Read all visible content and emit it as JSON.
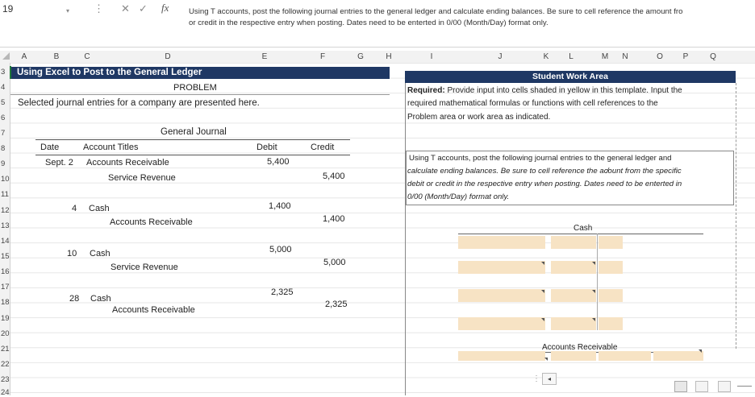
{
  "formula_bar": {
    "name_box": "19",
    "fx_label": "fx",
    "formula_line1": "Using T accounts, post the following journal entries to the general ledger and calculate ending balances. Be sure to cell reference the amount fro",
    "formula_line2": "or credit in the respective entry when posting. Dates need to be enterted in 0/00 (Month/Day) format only."
  },
  "columns": [
    "A",
    "B",
    "C",
    "D",
    "E",
    "F",
    "G",
    "H",
    "I",
    "J",
    "K",
    "L",
    "M",
    "N",
    "O",
    "P",
    "Q"
  ],
  "rows": [
    "3",
    "4",
    "5",
    "6",
    "7",
    "8",
    "9",
    "10",
    "11",
    "12",
    "13",
    "14",
    "15",
    "16",
    "17",
    "18",
    "19",
    "20",
    "21",
    "22",
    "23",
    "24"
  ],
  "left": {
    "title": "Using Excel to Post to the General Ledger",
    "problem": "PROBLEM",
    "intro": "Selected journal entries for a company are presented here.",
    "journal_title": "General Journal",
    "headers": {
      "date": "Date",
      "account": "Account Titles",
      "debit": "Debit",
      "credit": "Credit"
    },
    "entries": [
      {
        "date": "Sept. 2",
        "debit_account": "Accounts Receivable",
        "debit": "5,400",
        "credit_account": "Service Revenue",
        "credit": "5,400"
      },
      {
        "date": "4",
        "debit_account": "Cash",
        "debit": "1,400",
        "credit_account": "Accounts Receivable",
        "credit": "1,400"
      },
      {
        "date": "10",
        "debit_account": "Cash",
        "debit": "5,000",
        "credit_account": "Service Revenue",
        "credit": "5,000"
      },
      {
        "date": "28",
        "debit_account": "Cash",
        "debit": "2,325",
        "credit_account": "Accounts Receivable",
        "credit": "2,325"
      }
    ]
  },
  "right": {
    "title": "Student Work Area",
    "required_label": "Required:",
    "required_text1": " Provide input into cells shaded in yellow in this template. Input the",
    "required_text2": "required mathematical formulas or functions with cell references to the",
    "required_text3": "Problem area or work area as indicated.",
    "instr1": "Using T accounts, post the following journal entries to the general ledger and",
    "instr2": "calculate ending balances. Be sure to cell reference the ac̸ount from the specific",
    "instr3": "debit or credit in the respective entry when posting. Dates need to be enterted in",
    "instr4": "0/00 (Month/Day) format only.",
    "cash_label": "Cash",
    "ar_label": "Accounts Receivable"
  },
  "colors": {
    "title_bg": "#1f3864",
    "input_fill": "#f7e3c4"
  }
}
